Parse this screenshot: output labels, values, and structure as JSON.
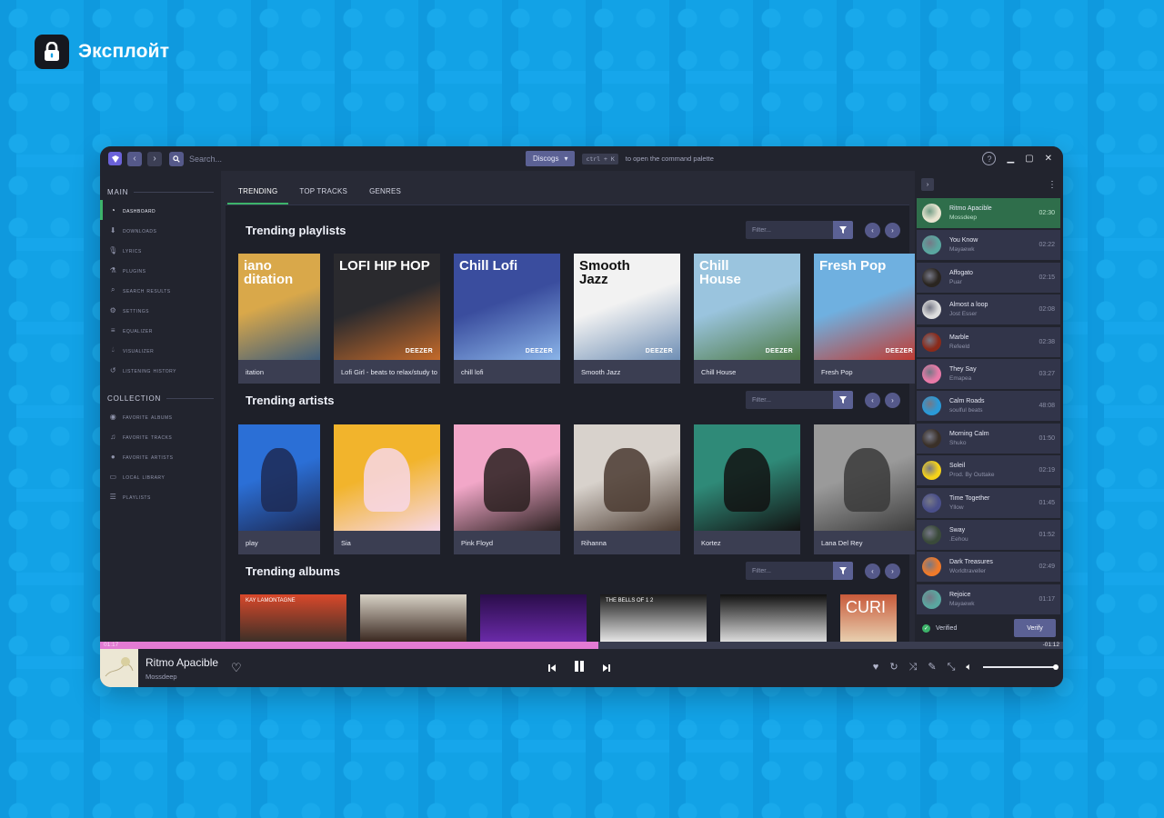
{
  "brand": {
    "name": "Эксплойт"
  },
  "topbar": {
    "search_placeholder": "Search...",
    "source_label": "Discogs",
    "shortcut": "ctrl + K",
    "palette_hint": "to open the command palette",
    "help": "?"
  },
  "sidebar": {
    "main_title": "Main",
    "main_items": [
      {
        "label": "Dashboard",
        "icon": "dashboard-icon",
        "active": true
      },
      {
        "label": "Downloads",
        "icon": "download-icon"
      },
      {
        "label": "Lyrics",
        "icon": "microphone-icon"
      },
      {
        "label": "Plugins",
        "icon": "flask-icon"
      },
      {
        "label": "Search Results",
        "icon": "search-icon"
      },
      {
        "label": "Settings",
        "icon": "gear-icon"
      },
      {
        "label": "Equalizer",
        "icon": "sliders-icon"
      },
      {
        "label": "Visualizer",
        "icon": "droplet-icon"
      },
      {
        "label": "Listening History",
        "icon": "history-icon"
      }
    ],
    "collection_title": "Collection",
    "collection_items": [
      {
        "label": "Favorite Albums",
        "icon": "disc-icon"
      },
      {
        "label": "Favorite Tracks",
        "icon": "music-icon"
      },
      {
        "label": "Favorite Artists",
        "icon": "user-icon"
      },
      {
        "label": "Local Library",
        "icon": "hdd-icon"
      },
      {
        "label": "Playlists",
        "icon": "list-icon"
      }
    ]
  },
  "tabs": [
    "Trending",
    "Top Tracks",
    "Genres"
  ],
  "trending_playlists": {
    "title": "Trending playlists",
    "filter_placeholder": "Filter...",
    "items": [
      {
        "label": "itation",
        "cover_text": "iano\nditation",
        "badge": "",
        "colors": [
          "#d9a84a",
          "#3e5c7a"
        ]
      },
      {
        "label": "Lofi Girl - beats to relax/study to",
        "cover_text": "LOFI HIP HOP",
        "badge": "DEEZER",
        "colors": [
          "#2a2a2e",
          "#c46a2a"
        ]
      },
      {
        "label": "chill lofi",
        "cover_text": "Chill Lofi",
        "badge": "DEEZER",
        "colors": [
          "#3a4d9e",
          "#8ab4e8"
        ]
      },
      {
        "label": "Smooth Jazz",
        "cover_text": "Smooth\nJazz",
        "badge": "DEEZER",
        "colors": [
          "#f2f2f2",
          "#6f8fb5"
        ]
      },
      {
        "label": "Chill House",
        "cover_text": "Chill\nHouse",
        "badge": "DEEZER",
        "colors": [
          "#9ac4de",
          "#4e7a45"
        ]
      },
      {
        "label": "Fresh Pop",
        "cover_text": "Fresh Pop",
        "badge": "DEEZER",
        "colors": [
          "#6fb0e0",
          "#c2382e"
        ]
      }
    ]
  },
  "trending_artists": {
    "title": "Trending artists",
    "filter_placeholder": "Filter...",
    "items": [
      {
        "label": "play",
        "colors": [
          "#2b6fd6",
          "#1d2a55"
        ]
      },
      {
        "label": "Sia",
        "colors": [
          "#f2b42c",
          "#f7d7e7"
        ]
      },
      {
        "label": "Pink Floyd",
        "colors": [
          "#f2a7c8",
          "#2a2020"
        ]
      },
      {
        "label": "Rihanna",
        "colors": [
          "#d8d2cc",
          "#4a3a30"
        ]
      },
      {
        "label": "Kortez",
        "colors": [
          "#2f8a78",
          "#121212"
        ]
      },
      {
        "label": "Lana Del Rey",
        "colors": [
          "#9a9a9a",
          "#3a3a3a"
        ]
      }
    ]
  },
  "trending_albums": {
    "title": "Trending albums",
    "filter_placeholder": "Filter...",
    "items": [
      {
        "label": "KAY LAMONTAGNE",
        "colors": [
          "#d9482a",
          "#3c3028"
        ]
      },
      {
        "label": "",
        "colors": [
          "#d8d2c6",
          "#3a2820"
        ]
      },
      {
        "label": "",
        "colors": [
          "#2a0d4a",
          "#6a2aa8"
        ]
      },
      {
        "label": "THE BELLS OF 1 2",
        "colors": [
          "#1a1a1a",
          "#e6e6e6"
        ]
      },
      {
        "label": "",
        "colors": [
          "#111111",
          "#dcdcdc"
        ]
      },
      {
        "label": "CURI",
        "colors": [
          "#c85a3a",
          "#e8d0b0"
        ]
      }
    ]
  },
  "queue": {
    "items": [
      {
        "title": "Ritmo Apacible",
        "artist": "Mossdeep",
        "duration": "02:30",
        "playing": true,
        "color": "#e8e4d0"
      },
      {
        "title": "You Know",
        "artist": "Mayaewk",
        "duration": "02:22",
        "color": "#5aa7a0"
      },
      {
        "title": "Affogato",
        "artist": "Puar",
        "duration": "02:15",
        "color": "#2a2520"
      },
      {
        "title": "Almost a loop",
        "artist": "Jost Esser",
        "duration": "02:08",
        "color": "#dddddd"
      },
      {
        "title": "Marble",
        "artist": "Refeeld",
        "duration": "02:38",
        "color": "#8a2a1a"
      },
      {
        "title": "They Say",
        "artist": "Emapea",
        "duration": "03:27",
        "color": "#e87aa8"
      },
      {
        "title": "Calm Roads",
        "artist": "soulful beats",
        "duration": "48:08",
        "color": "#2a9ad8"
      },
      {
        "title": "Morning Calm",
        "artist": "Shuko",
        "duration": "01:50",
        "color": "#3a3028"
      },
      {
        "title": "Soleil",
        "artist": "Prod. By Outtake",
        "duration": "02:19",
        "color": "#f5d21a"
      },
      {
        "title": "Time Together",
        "artist": "Yllow",
        "duration": "01:45",
        "color": "#4a4f8a"
      },
      {
        "title": "Sway",
        "artist": ".Eehou",
        "duration": "01:52",
        "color": "#3a4a3a"
      },
      {
        "title": "Dark Treasures",
        "artist": "Worldtraveller",
        "duration": "02:49",
        "color": "#f07a2a"
      },
      {
        "title": "Rejoice",
        "artist": "Mayaewk",
        "duration": "01:17",
        "color": "#5aa7a0"
      }
    ],
    "verified_label": "Verified",
    "verify_button": "Verify"
  },
  "player": {
    "title": "Ritmo Apacible",
    "artist": "Mossdeep",
    "elapsed": "01:17",
    "remaining": "-01:12",
    "progress": 0.517,
    "volume": 1.0
  },
  "colors": {
    "accent": "#3db36a",
    "primary": "#5b6194",
    "progress": "#e37bd3"
  }
}
